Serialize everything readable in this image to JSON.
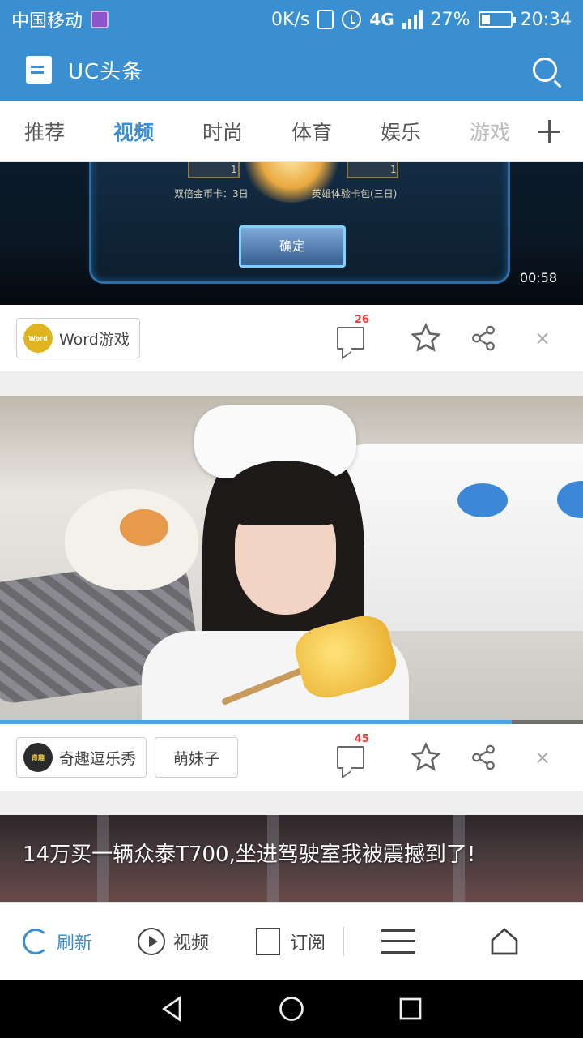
{
  "status_bar": {
    "carrier": "中国移动",
    "speed": "0K/s",
    "network": "4G",
    "network_small": "4G",
    "battery": "27%",
    "time": "20:34"
  },
  "header": {
    "title": "UC头条"
  },
  "tabs": [
    "推荐",
    "视频",
    "时尚",
    "体育",
    "娱乐",
    "游戏"
  ],
  "active_tab": "视频",
  "feed": {
    "item1": {
      "duration": "00:58",
      "game_captions": [
        "双倍金币卡：3日",
        "英雄体验卡包(三日)"
      ],
      "game_item_counts": [
        "1",
        "1"
      ],
      "game_button": "确定",
      "source": "Word游戏",
      "source_logo_text": "Word",
      "comments": "26"
    },
    "item2": {
      "source": "奇趣逗乐秀",
      "source_logo_text": "奇趣",
      "tag": "萌妹子",
      "comments": "45",
      "progress_fraction": 0.878
    },
    "item3": {
      "headline": "14万买一辆众泰T700,坐进驾驶室我被震撼到了!"
    }
  },
  "toolbar": {
    "refresh": "刷新",
    "video": "视频",
    "subscribe": "订阅"
  },
  "colors": {
    "brand": "#3a8fd0",
    "badge": "#e8403c"
  }
}
